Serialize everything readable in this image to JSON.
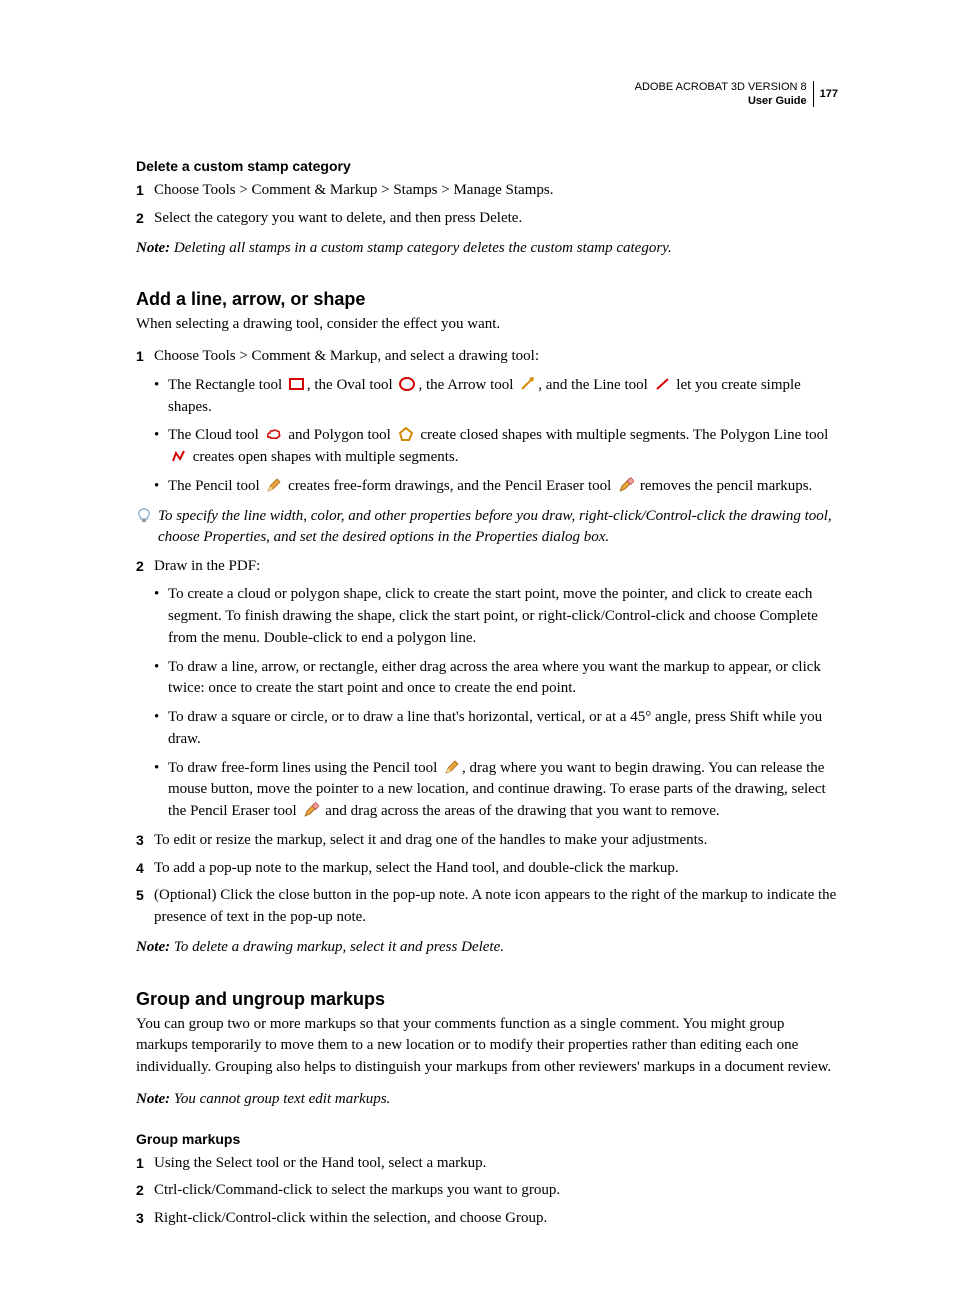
{
  "header": {
    "product": "ADOBE ACROBAT 3D VERSION 8",
    "guide": "User Guide",
    "page": "177"
  },
  "s1": {
    "title": "Delete a custom stamp category",
    "step1": "Choose Tools > Comment & Markup > Stamps > Manage Stamps.",
    "step2": "Select the category you want to delete, and then press Delete.",
    "note_label": "Note:",
    "note_body": "Deleting all stamps in a custom stamp category deletes the custom stamp category."
  },
  "s2": {
    "title": "Add a line, arrow, or shape",
    "intro": "When selecting a drawing tool, consider the effect you want.",
    "step1": "Choose Tools > Comment & Markup, and select a drawing tool:",
    "b1a": "The Rectangle tool ",
    "b1b": ", the Oval tool ",
    "b1c": ", the Arrow tool ",
    "b1d": ", and the Line tool ",
    "b1e": " let you create simple shapes.",
    "b2a": "The Cloud tool ",
    "b2b": " and Polygon tool ",
    "b2c": " create closed shapes with multiple segments. The Polygon Line tool ",
    "b2d": " creates open shapes with multiple segments.",
    "b3a": "The Pencil tool ",
    "b3b": " creates free-form drawings, and the Pencil Eraser tool ",
    "b3c": " removes the pencil markups.",
    "tip": "To specify the line width, color, and other properties before you draw, right-click/Control-click the drawing tool, choose Properties, and set the desired options in the Properties dialog box.",
    "step2": "Draw in the PDF:",
    "b4": "To create a cloud or polygon shape, click to create the start point, move the pointer, and click to create each segment. To finish drawing the shape, click the start point, or right-click/Control-click and choose Complete from the menu. Double-click to end a polygon line.",
    "b5": "To draw a line, arrow, or rectangle, either drag across the area where you want the markup to appear, or click twice: once to create the start point and once to create the end point.",
    "b6": "To draw a square or circle, or to draw a line that's horizontal, vertical, or at a 45° angle, press Shift while you draw.",
    "b7a": "To draw free-form lines using the Pencil tool ",
    "b7b": ", drag where you want to begin drawing. You can release the mouse button, move the pointer to a new location, and continue drawing. To erase parts of the drawing, select the Pencil Eraser tool ",
    "b7c": " and drag across the areas of the drawing that you want to remove.",
    "step3": "To edit or resize the markup, select it and drag one of the handles to make your adjustments.",
    "step4": "To add a pop-up note to the markup, select the Hand tool, and double-click the markup.",
    "step5": "(Optional) Click the close button in the pop-up note. A note icon appears to the right of the markup to indicate the presence of text in the pop-up note.",
    "note_label": "Note:",
    "note_body": "To delete a drawing markup, select it and press Delete."
  },
  "s3": {
    "title": "Group and ungroup markups",
    "intro": "You can group two or more markups so that your comments function as a single comment. You might group markups temporarily to move them to a new location or to modify their properties rather than editing each one individually. Grouping also helps to distinguish your markups from other reviewers' markups in a document review.",
    "note_label": "Note:",
    "note_body": "You cannot group text edit markups."
  },
  "s4": {
    "title": "Group markups",
    "step1": "Using the Select tool or the Hand tool, select a markup.",
    "step2": "Ctrl-click/Command-click to select the markups you want to group.",
    "step3": "Right-click/Control-click within the selection, and choose Group."
  }
}
